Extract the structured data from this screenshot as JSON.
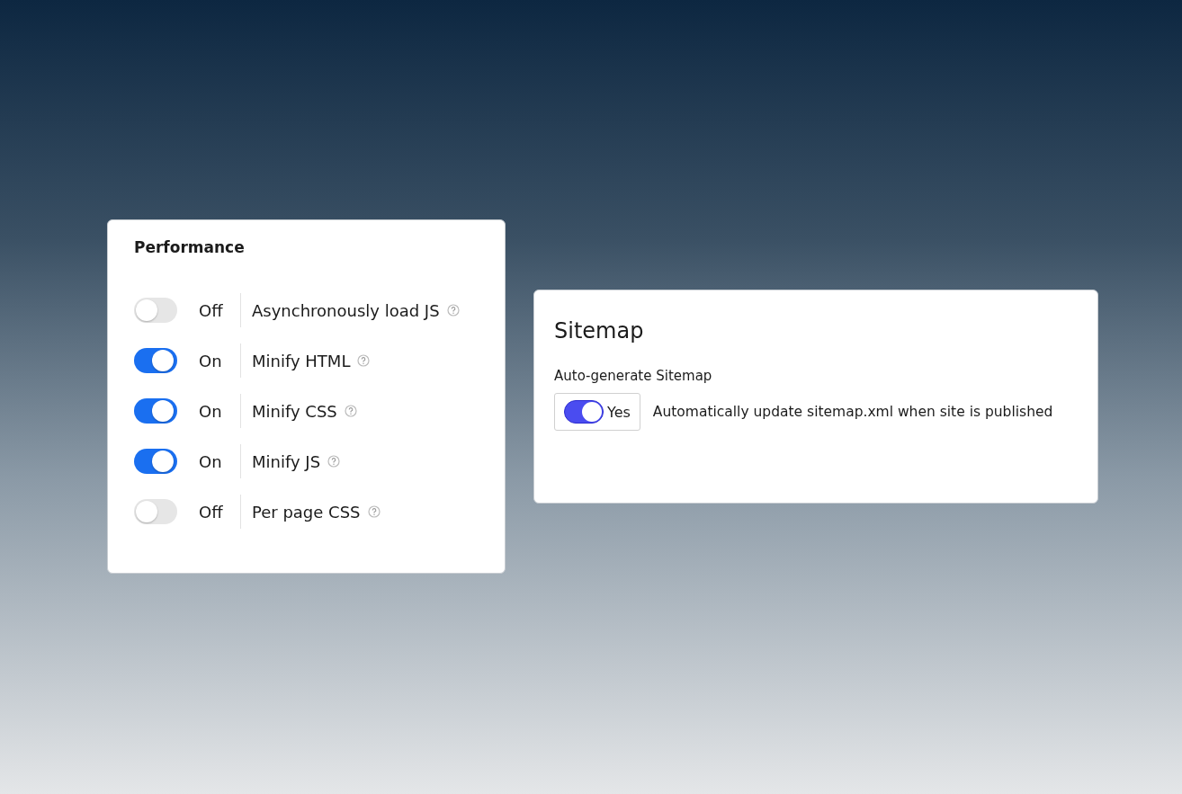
{
  "performance": {
    "title": "Performance",
    "settings": [
      {
        "on": false,
        "status": "Off",
        "label": "Asynchronously load JS"
      },
      {
        "on": true,
        "status": "On",
        "label": "Minify HTML"
      },
      {
        "on": true,
        "status": "On",
        "label": "Minify CSS"
      },
      {
        "on": true,
        "status": "On",
        "label": "Minify JS"
      },
      {
        "on": false,
        "status": "Off",
        "label": "Per page CSS"
      }
    ]
  },
  "sitemap": {
    "title": "Sitemap",
    "field_label": "Auto-generate Sitemap",
    "on": true,
    "toggle_text": "Yes",
    "description": "Automatically update sitemap.xml when site is published"
  }
}
